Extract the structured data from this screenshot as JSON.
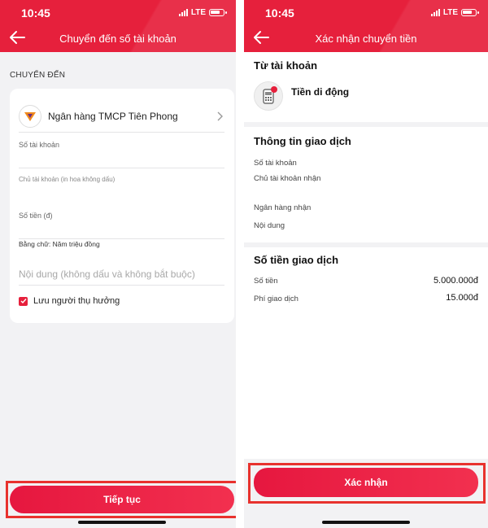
{
  "left_screen": {
    "status": {
      "time": "10:45",
      "network": "LTE"
    },
    "title": "Chuyển đến số tài khoản",
    "section_label": "CHUYỂN ĐẾN",
    "bank_name": "Ngân hàng TMCP Tiên Phong",
    "account_number_label": "Số tài khoản",
    "account_holder_label": "Chủ tài khoản (in hoa không dấu)",
    "amount_label": "Số tiền (đ)",
    "amount_in_words": "Bằng chữ: Năm triệu đồng",
    "note_placeholder": "Nội dung (không dấu và không bắt buộc)",
    "save_beneficiary_label": "Lưu người thụ hưởng",
    "save_beneficiary_checked": true,
    "continue_button": "Tiếp tục"
  },
  "right_screen": {
    "status": {
      "time": "10:45",
      "network": "LTE"
    },
    "title": "Xác nhận chuyển tiền",
    "from_account_heading": "Từ tài khoản",
    "from_account_name": "Tiền di động",
    "transaction_info_heading": "Thông tin giao dịch",
    "info_rows": [
      {
        "label": "Số tài khoản"
      },
      {
        "label": "Chủ tài khoản nhận"
      },
      {
        "label": "Ngân hàng nhận"
      },
      {
        "label": "Nội dung"
      }
    ],
    "amount_heading": "Số tiền giao dịch",
    "amount_rows": [
      {
        "label": "Số tiền",
        "value": "5.000.000đ"
      },
      {
        "label": "Phí giao dịch",
        "value": "15.000đ"
      }
    ],
    "confirm_button": "Xác nhận"
  },
  "colors": {
    "brand_red": "#e6203c",
    "highlight_frame": "#e8322e",
    "background_gray": "#f2f2f4"
  },
  "icons": [
    "back-arrow-icon",
    "tpbank-logo-icon",
    "chevron-right-icon",
    "checkmark-icon",
    "mobile-wallet-icon",
    "signal-icon",
    "battery-icon"
  ]
}
